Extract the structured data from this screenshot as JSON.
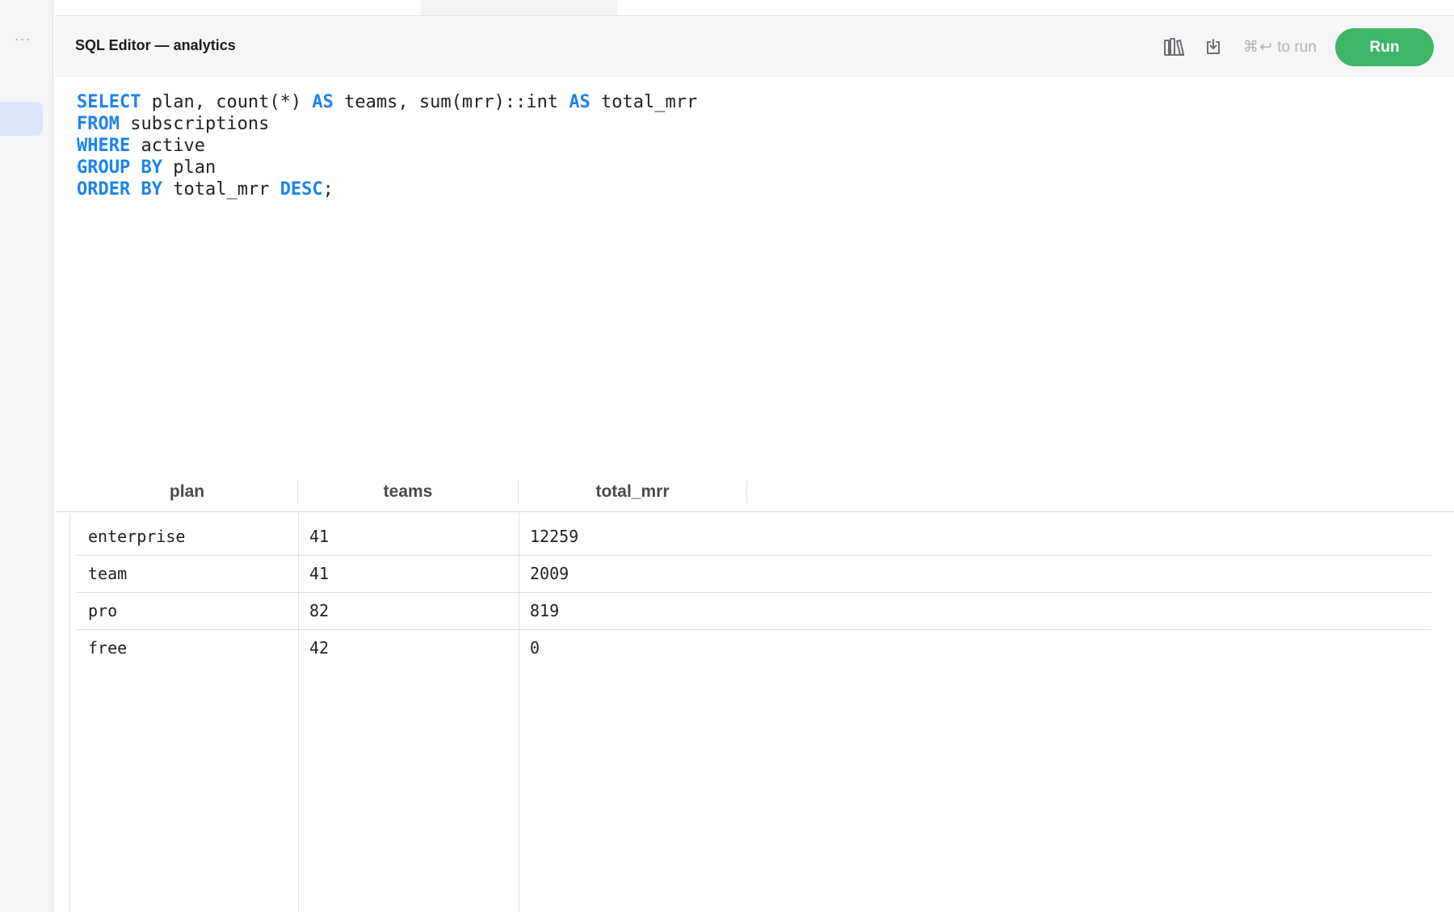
{
  "tabs": {
    "icon": "more-icon"
  },
  "header": {
    "title": "SQL Editor — analytics",
    "icons": [
      "library-icon",
      "download-icon"
    ],
    "hint_keys": "⌘↩",
    "hint_text": "to run",
    "run_label": "Run",
    "run_color": "#3fb567"
  },
  "editor": {
    "keyword_color": "#1d82f0",
    "lines": [
      [
        {
          "t": "SELECT",
          "kw": true
        },
        {
          "t": " plan, count(*) "
        },
        {
          "t": "AS",
          "kw": true
        },
        {
          "t": " teams, sum(mrr)::int "
        },
        {
          "t": "AS",
          "kw": true
        },
        {
          "t": " total_mrr"
        }
      ],
      [
        {
          "t": "FROM",
          "kw": true
        },
        {
          "t": " subscriptions"
        }
      ],
      [
        {
          "t": "WHERE",
          "kw": true
        },
        {
          "t": " active"
        }
      ],
      [
        {
          "t": "GROUP",
          "kw": true
        },
        {
          "t": " "
        },
        {
          "t": "BY",
          "kw": true
        },
        {
          "t": " plan"
        }
      ],
      [
        {
          "t": "ORDER",
          "kw": true
        },
        {
          "t": " "
        },
        {
          "t": "BY",
          "kw": true
        },
        {
          "t": " total_mrr "
        },
        {
          "t": "DESC",
          "kw": true
        },
        {
          "t": ";"
        }
      ]
    ]
  },
  "results": {
    "columns": [
      "plan",
      "teams",
      "total_mrr"
    ],
    "rows": [
      [
        "enterprise",
        "41",
        "12259"
      ],
      [
        "team",
        "41",
        "2009"
      ],
      [
        "pro",
        "82",
        "819"
      ],
      [
        "free",
        "42",
        "0"
      ]
    ]
  }
}
